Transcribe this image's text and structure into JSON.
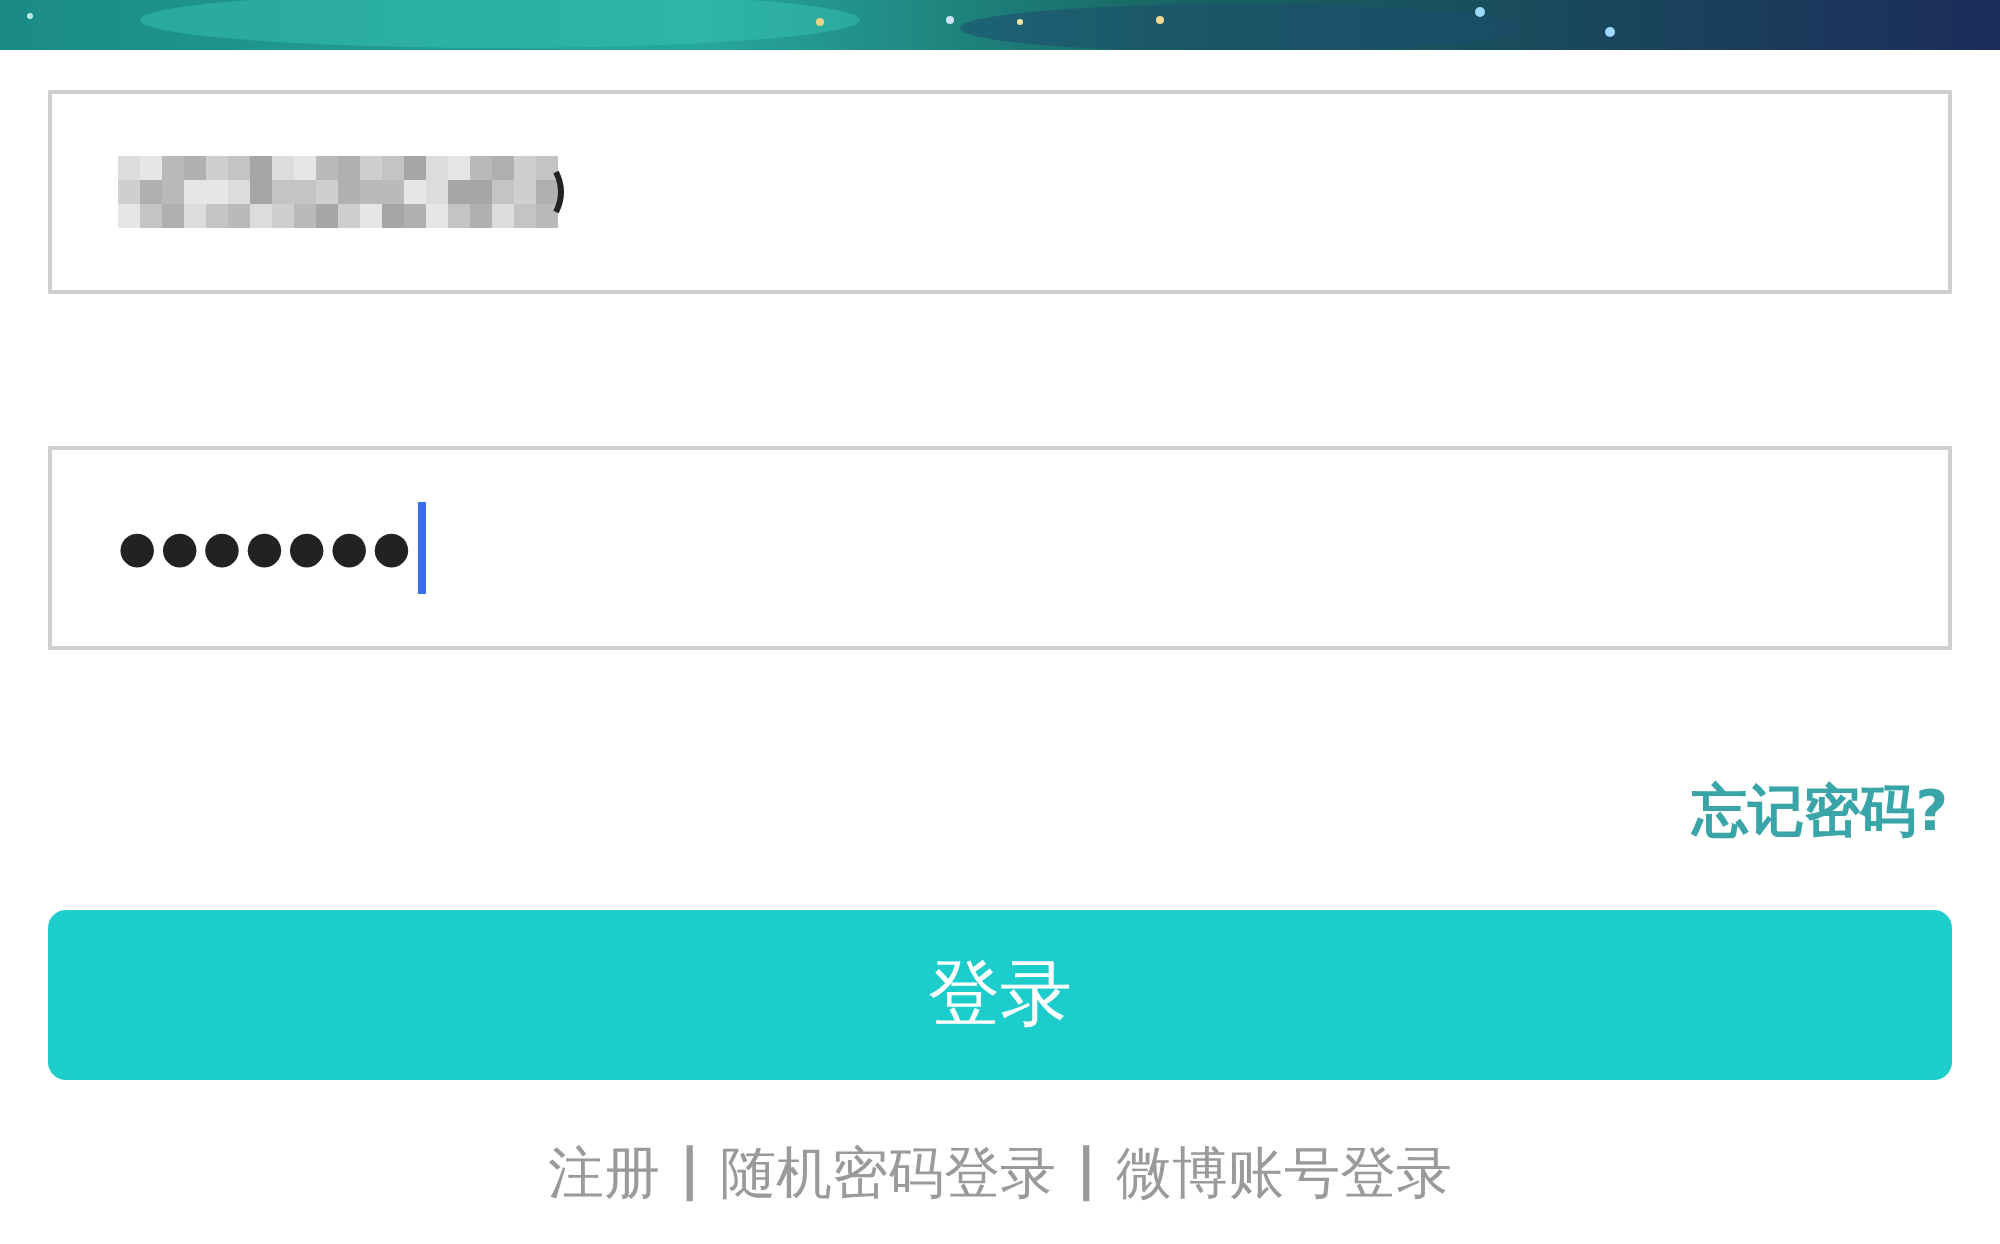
{
  "username_field": {
    "kind": "redacted"
  },
  "password_field": {
    "value": "●●●●●●●",
    "focused": true
  },
  "forgot_link": "忘记密码?",
  "login_button": "登录",
  "footer_links": [
    {
      "kind": "link",
      "text": "注册"
    },
    {
      "kind": "separator",
      "text": "|"
    },
    {
      "kind": "link",
      "text": "随机密码登录"
    },
    {
      "kind": "separator",
      "text": "|"
    },
    {
      "kind": "link",
      "text": "微博账号登录"
    }
  ]
}
